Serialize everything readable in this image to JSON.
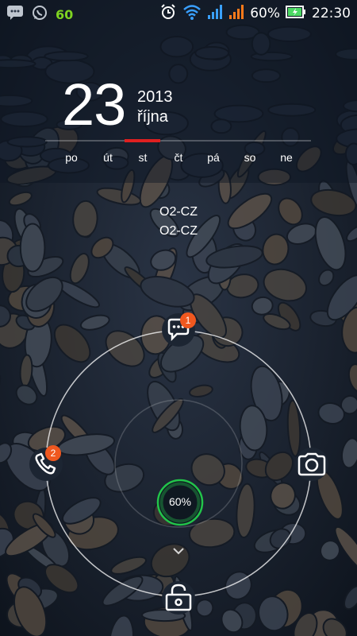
{
  "status_bar": {
    "left_number": "60",
    "battery_percent": "60%",
    "time": "22:30",
    "icons": [
      "message-icon",
      "whatsapp-icon",
      "alarm-icon",
      "wifi-icon",
      "signal-blue-icon",
      "signal-orange-icon",
      "battery-charging-icon"
    ]
  },
  "clock": {
    "day": "23",
    "year": "2013",
    "month": "října"
  },
  "week": {
    "days": [
      "po",
      "út",
      "st",
      "čt",
      "pá",
      "so",
      "ne"
    ],
    "active_index": 2
  },
  "carrier": {
    "line1": "O2-CZ",
    "line2": "O2-CZ"
  },
  "lock_ring": {
    "message_badge": "1",
    "phone_badge": "2",
    "battery_level": "60%",
    "icons": [
      "message-icon",
      "phone-icon",
      "camera-icon",
      "unlock-icon",
      "chevron-down-icon"
    ]
  }
}
